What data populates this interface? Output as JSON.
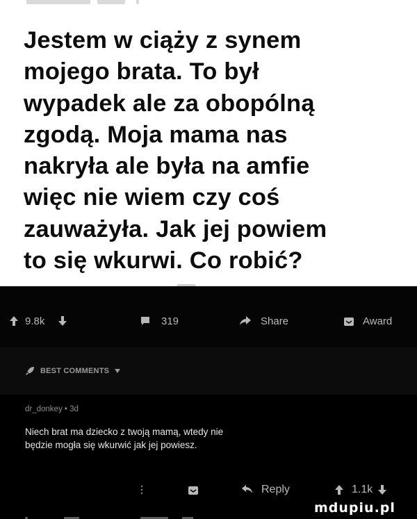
{
  "post": {
    "lines": [
      "Jestem w ciąży z synem",
      "mojego brata. To był",
      "wypadek ale za obopólną",
      "zgodą. Moja mama nas",
      "nakryła ale była na amfie",
      "więc nie wiem czy coś",
      "zauważyła. Jak jej powiem",
      "to się wkurwi. Co robić?"
    ]
  },
  "actions": {
    "upvotes": "9.8k",
    "comments": "319",
    "share": "Share",
    "award": "Award"
  },
  "best_comments": {
    "label": "BEST COMMENTS"
  },
  "comment": {
    "meta": "dr_donkey • 3d",
    "lines": [
      "Niech brat ma dziecko z twoją mamą, wtedy nie",
      "będzie mogła się wkurwić jak jej powiesz."
    ],
    "reply": "Reply",
    "votes": "1.1k"
  },
  "watermark": "mdupiu.pl",
  "colors": {
    "post_bg": "#ffffff",
    "post_text": "#0c0c0c",
    "dark_bg": "#050505",
    "icon_gray": "#b8b8b8"
  }
}
